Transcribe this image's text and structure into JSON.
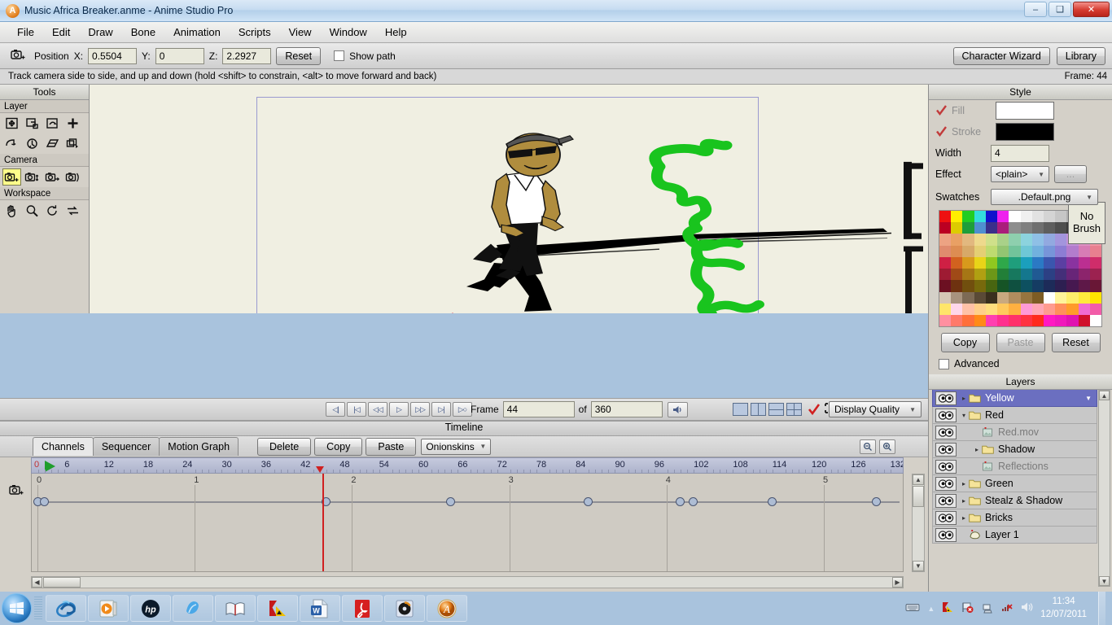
{
  "window": {
    "title": "Music Africa Breaker.anme - Anime Studio Pro",
    "icon": "app-icon",
    "minimize": "–",
    "maximize": "❑",
    "close": "✕"
  },
  "menu": {
    "items": [
      "File",
      "Edit",
      "Draw",
      "Bone",
      "Animation",
      "Scripts",
      "View",
      "Window",
      "Help"
    ]
  },
  "toolbar": {
    "position_label": "Position",
    "x_label": "X:",
    "x_value": "0.5504",
    "y_label": "Y:",
    "y_value": "0",
    "z_label": "Z:",
    "z_value": "2.2927",
    "reset_label": "Reset",
    "show_path_label": "Show path",
    "show_path_checked": false,
    "character_wizard_label": "Character Wizard",
    "library_label": "Library"
  },
  "status": {
    "hint": "Track camera side to side, and up and down (hold <shift> to constrain, <alt> to move forward and back)",
    "frame_indicator": "Frame: 44"
  },
  "tools": {
    "title": "Tools",
    "groups": [
      {
        "name": "Layer",
        "label": "Layer",
        "tools": [
          {
            "name": "translate-layer-tool",
            "glyph": "move"
          },
          {
            "name": "scale-layer-tool",
            "glyph": "scale"
          },
          {
            "name": "rotate-layer-tool",
            "glyph": "rotatelayer"
          },
          {
            "name": "add-layer-tool",
            "glyph": "plus"
          },
          {
            "name": "rotate-layer-xy-tool",
            "glyph": "arc"
          },
          {
            "name": "shear-layer-tool",
            "glyph": "shearz"
          },
          {
            "name": "shear-horizontal-tool",
            "glyph": "shearh"
          },
          {
            "name": "follow-path-tool",
            "glyph": "stack"
          }
        ]
      },
      {
        "name": "Camera",
        "label": "Camera",
        "tools": [
          {
            "name": "track-camera-tool",
            "glyph": "cam-plus",
            "active": true
          },
          {
            "name": "zoom-camera-tool",
            "glyph": "cam-updown"
          },
          {
            "name": "roll-camera-tool",
            "glyph": "cam-right"
          },
          {
            "name": "pan-tilt-camera-tool",
            "glyph": "cam-arc"
          }
        ]
      },
      {
        "name": "Workspace",
        "label": "Workspace",
        "tools": [
          {
            "name": "pan-workspace-tool",
            "glyph": "hand"
          },
          {
            "name": "zoom-workspace-tool",
            "glyph": "magnifier"
          },
          {
            "name": "rotate-workspace-tool",
            "glyph": "rotate-cw"
          },
          {
            "name": "reset-workspace-tool",
            "glyph": "reset-arrows"
          }
        ]
      }
    ]
  },
  "canvas": {
    "background": "#f0efe2",
    "frame_border": "#9a9ad0",
    "artwork_colors": {
      "skin": "#b08d3e",
      "shirt": "#ffffff",
      "pants": "#111111",
      "green_line": "#19c41e",
      "shadow": "#000000",
      "hat": "#555555"
    }
  },
  "playback": {
    "buttons": [
      {
        "name": "go-to-start-button",
        "glyph": "◁|"
      },
      {
        "name": "previous-keyframe-button",
        "glyph": "|◁"
      },
      {
        "name": "step-back-button",
        "glyph": "◁◁"
      },
      {
        "name": "play-button",
        "glyph": "▷"
      },
      {
        "name": "step-forward-button",
        "glyph": "▷▷"
      },
      {
        "name": "next-keyframe-button",
        "glyph": "▷|"
      },
      {
        "name": "go-to-end-button",
        "glyph": "▷○"
      }
    ],
    "frame_label": "Frame",
    "frame_value": "44",
    "of_label": "of",
    "total_value": "360",
    "audio_button": "speaker-icon",
    "display_quality_label": "Display Quality"
  },
  "timeline": {
    "title": "Timeline",
    "tabs": [
      {
        "label": "Channels",
        "active": true
      },
      {
        "label": "Sequencer",
        "active": false
      },
      {
        "label": "Motion Graph",
        "active": false
      }
    ],
    "actions": [
      "Delete",
      "Copy",
      "Paste"
    ],
    "onionskins_label": "Onionskins",
    "ruler_ticks": [
      0,
      6,
      12,
      18,
      24,
      30,
      36,
      42,
      48,
      54,
      60,
      66,
      72,
      78,
      84,
      90,
      96,
      102,
      108,
      114,
      120,
      126,
      132
    ],
    "second_marks": [
      "0",
      "1",
      "2",
      "3",
      "4",
      "5"
    ],
    "playhead_frame": 44,
    "keyframes_frames": [
      0,
      1,
      44,
      63,
      84,
      98,
      100,
      112,
      128
    ],
    "zoom_in": "zoom-in-icon",
    "zoom_out": "zoom-out-icon"
  },
  "style": {
    "title": "Style",
    "fill_label": "Fill",
    "fill_checked": true,
    "fill_color": "#ffffff",
    "stroke_label": "Stroke",
    "stroke_checked": true,
    "stroke_color": "#000000",
    "no_brush_label": "No Brush",
    "width_label": "Width",
    "width_value": "4",
    "effect_label": "Effect",
    "effect_value": "<plain>",
    "effect_more_label": "...",
    "swatches_label": "Swatches",
    "swatches_value": ".Default.png",
    "copy_label": "Copy",
    "paste_label": "Paste",
    "reset_label": "Reset",
    "advanced_label": "Advanced",
    "advanced_checked": false,
    "swatch_rows": [
      [
        "#ee1111",
        "#ffee00",
        "#22cc22",
        "#33dddd",
        "#1111cc",
        "#ee22ee",
        "#ffffff",
        "#f0f0f0",
        "#e2e2e2",
        "#d4d4d4",
        "#c6c6c6",
        "#b0b0b0",
        "#9a9a9a",
        "#8a8a8a"
      ],
      [
        "#bb0022",
        "#ddcc00",
        "#1e9e3a",
        "#4f8fd0",
        "#3a2f8a",
        "#aa1d7a",
        "#8d8d8d",
        "#7f7f7f",
        "#6f6f6f",
        "#5e5e5e",
        "#4e4e4e",
        "#3a3a3a",
        "#1f1f1f",
        "#000000"
      ],
      [
        "#eda383",
        "#e9a064",
        "#e2b87f",
        "#eed98c",
        "#cfe08a",
        "#a9d189",
        "#8ecfae",
        "#8cd3de",
        "#8fc0e6",
        "#92a9e0",
        "#a395dd",
        "#c192d6",
        "#dd92c2",
        "#ef97a3"
      ],
      [
        "#e08b6e",
        "#dd8d52",
        "#d7a969",
        "#e4cf74",
        "#bedb70",
        "#93c572",
        "#72c39b",
        "#6fc7d6",
        "#72b1de",
        "#7795d9",
        "#8d7dd4",
        "#b37ccd",
        "#d77cb5",
        "#e8808f"
      ],
      [
        "#cf2044",
        "#d2621f",
        "#d89a1c",
        "#e8d418",
        "#8fc820",
        "#2fa84a",
        "#1f9e7c",
        "#1b9fbd",
        "#2b79c4",
        "#3a56ae",
        "#5b3fa2",
        "#8a33a0",
        "#bb2f91",
        "#cf2d6a"
      ],
      [
        "#9e1b33",
        "#a04a17",
        "#a67615",
        "#b0a012",
        "#6c9718",
        "#227f38",
        "#17785e",
        "#14778e",
        "#205a93",
        "#2c4084",
        "#442f79",
        "#682578",
        "#8c246c",
        "#9c2250"
      ],
      [
        "#6c1022",
        "#6e3210",
        "#714f0e",
        "#77690c",
        "#486510",
        "#165426",
        "#0f5040",
        "#0d5060",
        "#153c63",
        "#1d2b59",
        "#2d1f51",
        "#461850",
        "#5e1848",
        "#691736"
      ],
      [
        "#d6c6b5",
        "#a8937e",
        "#7d6a55",
        "#5a4a36",
        "#3a2f1e",
        "#c9a97f",
        "#b08d5e",
        "#97753f",
        "#7d5c24",
        "#ffffff",
        "#fff39a",
        "#ffee6b",
        "#ffe93d",
        "#ffe400"
      ],
      [
        "#ffe56a",
        "#ffd7ea",
        "#ffc1a7",
        "#ffcf8a",
        "#ffdd7d",
        "#ffc95c",
        "#ffb040",
        "#ff9ad6",
        "#ffa6b4",
        "#ff9b8f",
        "#ff8f5c",
        "#ff9b2a",
        "#f06ad0",
        "#f25ca8"
      ],
      [
        "#ff8fa0",
        "#ff7a6a",
        "#ff6f3a",
        "#ff8a18",
        "#ff3fb0",
        "#ff2f8e",
        "#ff2f6a",
        "#ff3340",
        "#ff2a1c",
        "#ff18c2",
        "#f018bb",
        "#e012b0",
        "#d00f2a",
        "#ffffff"
      ]
    ]
  },
  "layers": {
    "title": "Layers",
    "toolbar": [
      {
        "name": "new-layer-button",
        "glyph": "new-layer-icon"
      },
      {
        "name": "duplicate-layer-button",
        "glyph": "add-layer-icon"
      },
      {
        "name": "delete-layer-button",
        "glyph": "trash-icon"
      },
      {
        "name": "layer-options-button",
        "glyph": "ellipsis-icon"
      }
    ],
    "items": [
      {
        "label": "Yellow",
        "type": "folder",
        "indent": 0,
        "selected": true,
        "expand": "collapsed",
        "dim": false
      },
      {
        "label": "Red",
        "type": "folder",
        "indent": 0,
        "selected": false,
        "expand": "expanded",
        "dim": false
      },
      {
        "label": "Red.mov",
        "type": "image",
        "indent": 1,
        "selected": false,
        "expand": "none",
        "dim": true
      },
      {
        "label": "Shadow",
        "type": "folder",
        "indent": 1,
        "selected": false,
        "expand": "collapsed",
        "dim": false
      },
      {
        "label": "Reflections",
        "type": "image",
        "indent": 1,
        "selected": false,
        "expand": "none",
        "dim": true
      },
      {
        "label": "Green",
        "type": "folder",
        "indent": 0,
        "selected": false,
        "expand": "collapsed",
        "dim": false
      },
      {
        "label": "Stealz & Shadow",
        "type": "folder",
        "indent": 0,
        "selected": false,
        "expand": "collapsed",
        "dim": false
      },
      {
        "label": "Bricks",
        "type": "folder",
        "indent": 0,
        "selected": false,
        "expand": "collapsed",
        "dim": false
      },
      {
        "label": "Layer 1",
        "type": "vector",
        "indent": 0,
        "selected": false,
        "expand": "none",
        "dim": false
      }
    ]
  },
  "taskbar": {
    "start_label": "start-orb",
    "items": [
      {
        "name": "taskbar-internet-explorer",
        "glyph": "ie"
      },
      {
        "name": "taskbar-media-player",
        "glyph": "wmp"
      },
      {
        "name": "taskbar-hp-app",
        "glyph": "hp"
      },
      {
        "name": "taskbar-msn",
        "glyph": "msn"
      },
      {
        "name": "taskbar-dictionary",
        "glyph": "book"
      },
      {
        "name": "taskbar-kaspersky",
        "glyph": "kaspersky"
      },
      {
        "name": "taskbar-word",
        "glyph": "word"
      },
      {
        "name": "taskbar-acrobat",
        "glyph": "pdf"
      },
      {
        "name": "taskbar-nero",
        "glyph": "nero"
      },
      {
        "name": "taskbar-anime-studio",
        "glyph": "anime"
      }
    ],
    "tray": [
      {
        "name": "tray-keyboard-icon",
        "glyph": "keyboard"
      },
      {
        "name": "tray-show-hidden-icon",
        "glyph": "chevron-up"
      },
      {
        "name": "tray-kaspersky-icon",
        "glyph": "kav"
      },
      {
        "name": "tray-flag-icon",
        "glyph": "flag"
      },
      {
        "name": "tray-network-icon",
        "glyph": "network"
      },
      {
        "name": "tray-volume-muted-icon",
        "glyph": "vol-mute"
      },
      {
        "name": "tray-volume-icon",
        "glyph": "volume"
      }
    ],
    "time": "11:34",
    "date": "12/07/2011"
  }
}
